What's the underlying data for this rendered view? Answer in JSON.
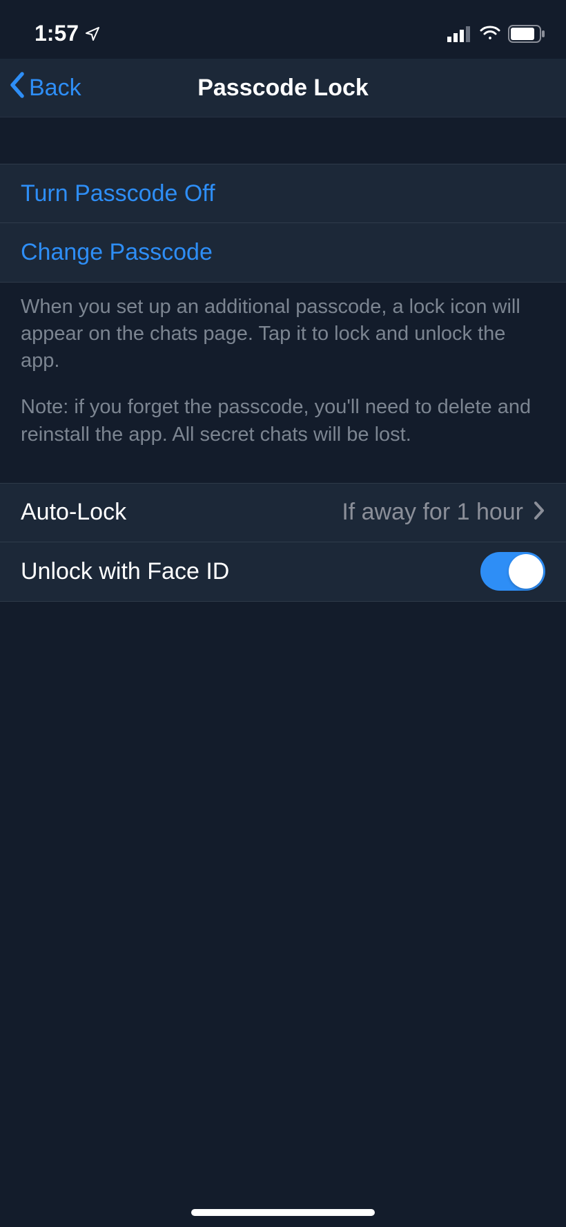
{
  "statusBar": {
    "time": "1:57"
  },
  "nav": {
    "backLabel": "Back",
    "title": "Passcode Lock"
  },
  "section1": {
    "turnOff": "Turn Passcode Off",
    "change": "Change Passcode"
  },
  "footer": {
    "p1": "When you set up an additional passcode, a lock icon will appear on the chats page. Tap it to lock and unlock the app.",
    "p2": "Note: if you forget the passcode, you'll need to delete and reinstall the app. All secret chats will be lost."
  },
  "section2": {
    "autoLockLabel": "Auto-Lock",
    "autoLockValue": "If away for 1 hour",
    "faceIdLabel": "Unlock with Face ID",
    "faceIdEnabled": true
  }
}
